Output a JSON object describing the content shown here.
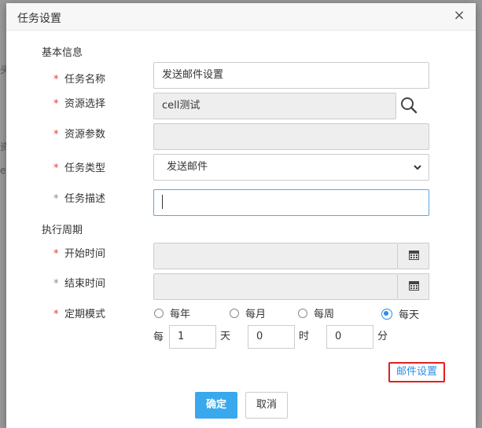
{
  "dialog": {
    "title": "任务设置",
    "close_symbol": "×"
  },
  "background": {
    "chars": [
      "头",
      "资",
      "e"
    ]
  },
  "sections": {
    "basic": "基本信息",
    "schedule": "执行周期"
  },
  "fields": {
    "task_name": {
      "label": "任务名称",
      "value": "发送邮件设置",
      "required": "*"
    },
    "resource_select": {
      "label": "资源选择",
      "value": "cell测试",
      "required": "*"
    },
    "resource_params": {
      "label": "资源参数",
      "value": "",
      "required": "*"
    },
    "task_type": {
      "label": "任务类型",
      "value": "发送邮件",
      "required": "*"
    },
    "task_desc": {
      "label": "任务描述",
      "value": "",
      "required": "*"
    },
    "start_time": {
      "label": "开始时间",
      "value": "",
      "required": "*"
    },
    "end_time": {
      "label": "结束时间",
      "value": "",
      "required": "*"
    },
    "schedule_mode": {
      "label": "定期模式",
      "required": "*"
    }
  },
  "schedule_options": [
    {
      "label": "每年",
      "selected": false
    },
    {
      "label": "每月",
      "selected": false
    },
    {
      "label": "每周",
      "selected": false
    },
    {
      "label": "每天",
      "selected": true
    }
  ],
  "interval": {
    "prefix": "每",
    "days": "1",
    "days_unit": "天",
    "hours": "0",
    "hours_unit": "时",
    "minutes": "0",
    "minutes_unit": "分"
  },
  "links": {
    "mail_settings": "邮件设置"
  },
  "buttons": {
    "confirm": "确定",
    "cancel": "取消"
  },
  "icons": {
    "search": "search-icon",
    "calendar": "calendar-icon",
    "close": "close-icon",
    "dropdown": "chevron-down-icon"
  },
  "colors": {
    "accent": "#3aa8ec",
    "required": "#e4393c",
    "highlight_border": "#e02020"
  }
}
